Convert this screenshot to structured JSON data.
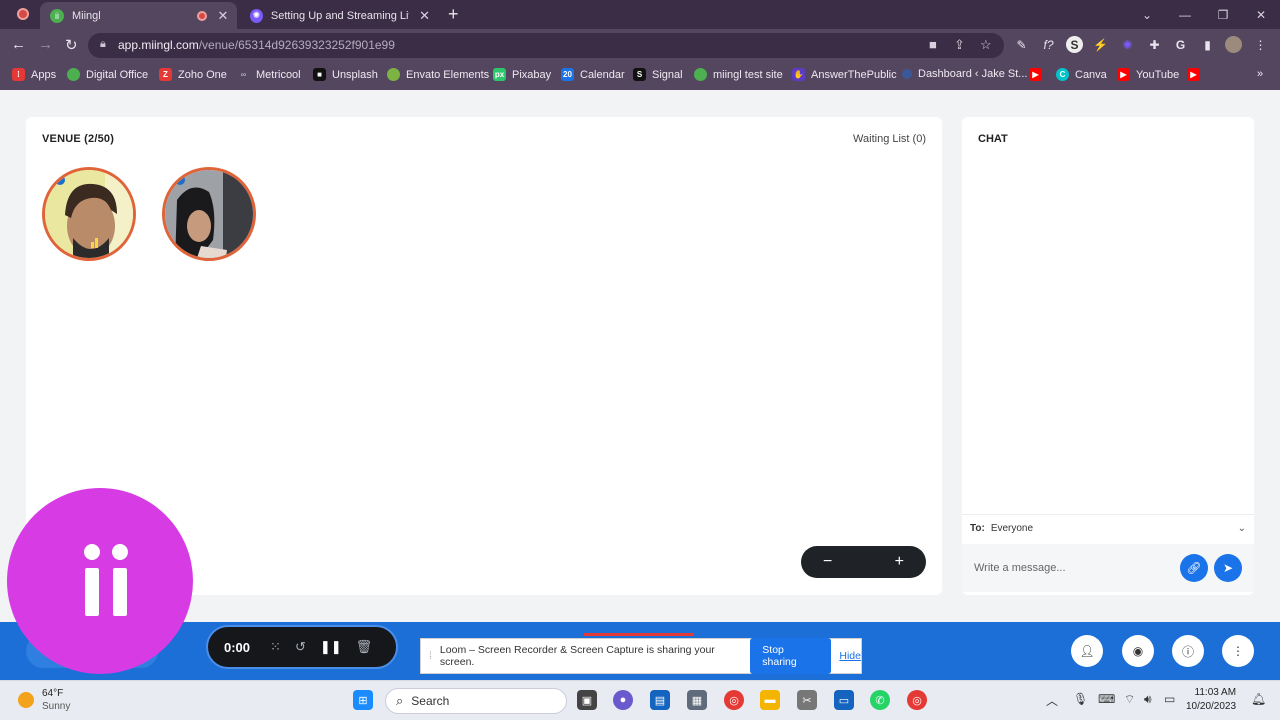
{
  "browser": {
    "tabs": [
      {
        "title": "Miingl",
        "active": true,
        "favicon_color": "#4caf50"
      },
      {
        "title": "Setting Up and Streaming Live o",
        "active": false,
        "favicon_color": "#7a5af8"
      }
    ],
    "new_tab": "+",
    "url_host": "app.miingl.com",
    "url_path": "/venue/65314d92639323252f901e99",
    "bookmarks": [
      {
        "label": "Apps",
        "color": "#e53935"
      },
      {
        "label": "Digital Office",
        "color": "#4caf50"
      },
      {
        "label": "Zoho One",
        "color": "#e53935"
      },
      {
        "label": "Metricool",
        "color": "#555555"
      },
      {
        "label": "Unsplash",
        "color": "#111111"
      },
      {
        "label": "Envato Elements",
        "color": "#7cb342"
      },
      {
        "label": "Pixabay",
        "color": "#2ec66d"
      },
      {
        "label": "Calendar",
        "color": "#1a73e8"
      },
      {
        "label": "Signal",
        "color": "#111111"
      },
      {
        "label": "miingl test site",
        "color": "#4caf50"
      },
      {
        "label": "AnswerThePublic",
        "color": "#5b3cc4"
      },
      {
        "label": "Dashboard ‹ Jake St...",
        "color": "#3b5998"
      },
      {
        "label": "Canva",
        "color": "#00c4cc"
      },
      {
        "label": "YouTube",
        "color": "#ff0000"
      }
    ]
  },
  "venue": {
    "title": "VENUE (2/50)",
    "waiting_list": "Waiting List (0)",
    "participants": [
      {
        "name": "participant-1",
        "tone": "#c7a37a"
      },
      {
        "name": "participant-2",
        "tone": "#8c8f95"
      }
    ],
    "zoom_minus": "−",
    "zoom_plus": "+"
  },
  "chat": {
    "title": "CHAT",
    "to_label": "To:",
    "to_value": "Everyone",
    "placeholder": "Write a message..."
  },
  "loom": {
    "time": "0:00",
    "notice": "Loom – Screen Recorder & Screen Capture is sharing your screen.",
    "stop": "Stop sharing",
    "hide": "Hide"
  },
  "taskbar": {
    "temp": "64°F",
    "condition": "Sunny",
    "search": "Search",
    "time": "11:03 AM",
    "date": "10/20/2023"
  },
  "colors": {
    "brand_magenta": "#d63be4",
    "bottom_bar": "#1b6fd6",
    "avatar_ring": "#e0643a"
  }
}
